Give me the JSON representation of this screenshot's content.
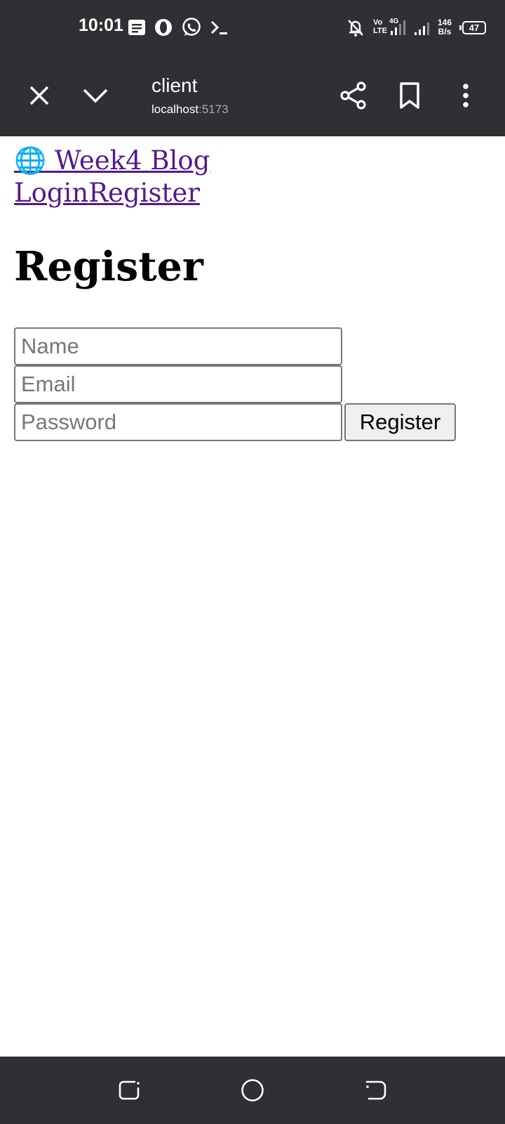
{
  "status_bar": {
    "time": "10:01",
    "icons": [
      "notes-icon",
      "opera-icon",
      "whatsapp-icon",
      "terminal-icon",
      "bell-off-icon",
      "volte-icon",
      "signal-icon",
      "signal-icon"
    ],
    "volte_top": "Vo",
    "volte_bottom": "LTE",
    "net_type": "4G",
    "net_rate_value": "146",
    "net_rate_unit": "B/s",
    "battery": "47"
  },
  "browser_toolbar": {
    "title": "client",
    "url_host": "localhost",
    "url_port": ":5173",
    "icons": [
      "close-icon",
      "chevron-down-icon",
      "share-icon",
      "bookmark-icon",
      "more-vert-icon"
    ]
  },
  "page": {
    "nav": {
      "brand": "🌐 Week4 Blog",
      "login": "Login",
      "register": "Register"
    },
    "heading": "Register",
    "form": {
      "name_placeholder": "Name",
      "email_placeholder": "Email",
      "password_placeholder": "Password",
      "submit_label": "Register"
    }
  },
  "system_nav": {
    "icons": [
      "recents-icon",
      "home-icon",
      "back-icon"
    ]
  },
  "colors": {
    "chrome": "#2f3034",
    "link": "#551a8b",
    "button_bg": "#efefef"
  }
}
